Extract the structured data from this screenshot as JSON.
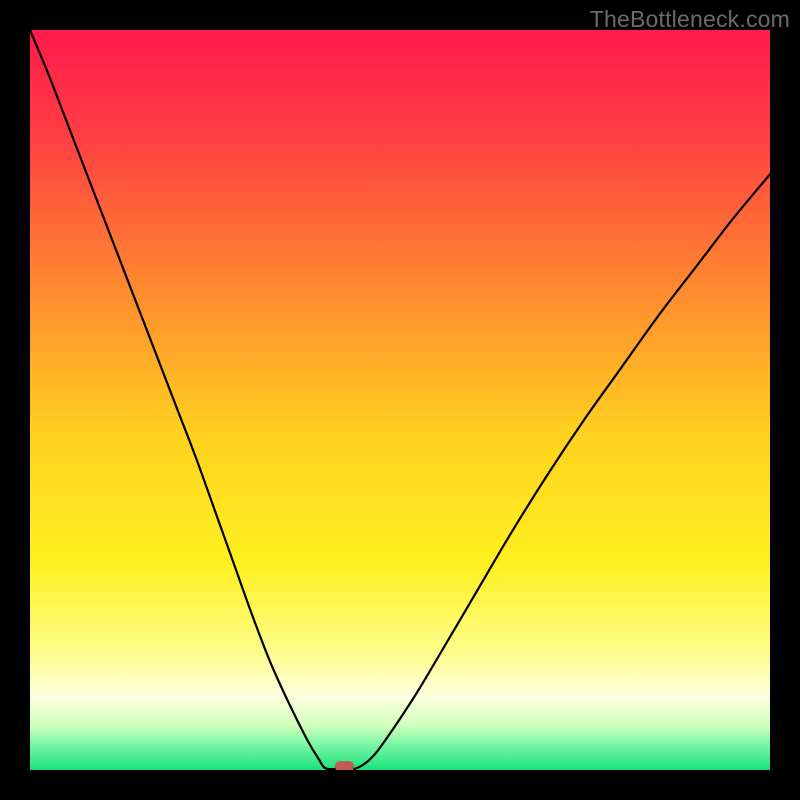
{
  "watermark": "TheBottleneck.com",
  "chart_data": {
    "type": "line",
    "title": "",
    "xlabel": "",
    "ylabel": "",
    "xlim": [
      0,
      100
    ],
    "ylim": [
      0,
      100
    ],
    "grid": false,
    "legend": false,
    "background_gradient": {
      "stops": [
        {
          "offset": 0.0,
          "color": "#ff1a4b"
        },
        {
          "offset": 0.15,
          "color": "#ff4142"
        },
        {
          "offset": 0.35,
          "color": "#ff8a2f"
        },
        {
          "offset": 0.55,
          "color": "#ffd21f"
        },
        {
          "offset": 0.72,
          "color": "#fff020"
        },
        {
          "offset": 0.84,
          "color": "#fdfe89"
        },
        {
          "offset": 0.9,
          "color": "#feffe0"
        },
        {
          "offset": 0.94,
          "color": "#d0ffb9"
        },
        {
          "offset": 0.965,
          "color": "#7cf6a7"
        },
        {
          "offset": 1.0,
          "color": "#19e27b"
        }
      ]
    },
    "series": [
      {
        "name": "bottleneck-curve",
        "color": "#000000",
        "x": [
          0.0,
          2.5,
          5.0,
          7.5,
          10.0,
          12.5,
          15.0,
          17.5,
          20.0,
          22.5,
          25.0,
          27.5,
          30.0,
          32.5,
          35.0,
          37.5,
          39.0,
          40.0,
          42.0,
          44.0,
          46.0,
          48.0,
          52.0,
          55.0,
          60.0,
          65.0,
          70.0,
          75.0,
          80.0,
          85.0,
          90.0,
          95.0,
          100.0
        ],
        "y": [
          100.0,
          94.0,
          87.5,
          81.0,
          74.5,
          68.0,
          61.5,
          55.0,
          48.5,
          42.0,
          35.0,
          28.0,
          21.0,
          14.5,
          9.0,
          4.0,
          1.5,
          0.2,
          0.2,
          0.2,
          1.5,
          4.0,
          10.0,
          15.0,
          23.5,
          32.0,
          40.0,
          47.5,
          54.5,
          61.5,
          68.0,
          74.5,
          80.5
        ]
      }
    ],
    "marker": {
      "name": "bottleneck-point",
      "shape": "rounded-rect",
      "x": 42.5,
      "y": 0.5,
      "color": "#c05a57",
      "width_pct": 2.6,
      "height_pct": 1.4
    }
  }
}
